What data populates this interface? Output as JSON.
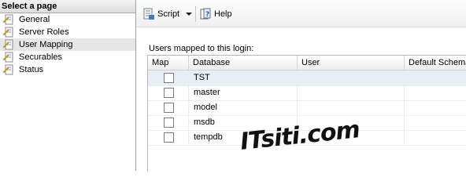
{
  "left": {
    "header": "Select a page",
    "items": [
      {
        "label": "General",
        "icon": "page-icon"
      },
      {
        "label": "Server Roles",
        "icon": "page-icon"
      },
      {
        "label": "User Mapping",
        "icon": "page-icon",
        "selected": true
      },
      {
        "label": "Securables",
        "icon": "page-icon"
      },
      {
        "label": "Status",
        "icon": "page-icon"
      }
    ]
  },
  "toolbar": {
    "script_label": "Script",
    "help_label": "Help"
  },
  "users_label": "Users mapped to this login:",
  "grid": {
    "columns": [
      "Map",
      "Database",
      "User",
      "Default Schema"
    ],
    "rows": [
      {
        "database": "TST",
        "user": "",
        "schema": "",
        "checked": false,
        "selected": true
      },
      {
        "database": "master",
        "user": "",
        "schema": "",
        "checked": false
      },
      {
        "database": "model",
        "user": "",
        "schema": "",
        "checked": false
      },
      {
        "database": "msdb",
        "user": "",
        "schema": "",
        "checked": false
      },
      {
        "database": "tempdb",
        "user": "",
        "schema": "",
        "checked": false
      }
    ]
  },
  "watermark": "ITsiti.com"
}
